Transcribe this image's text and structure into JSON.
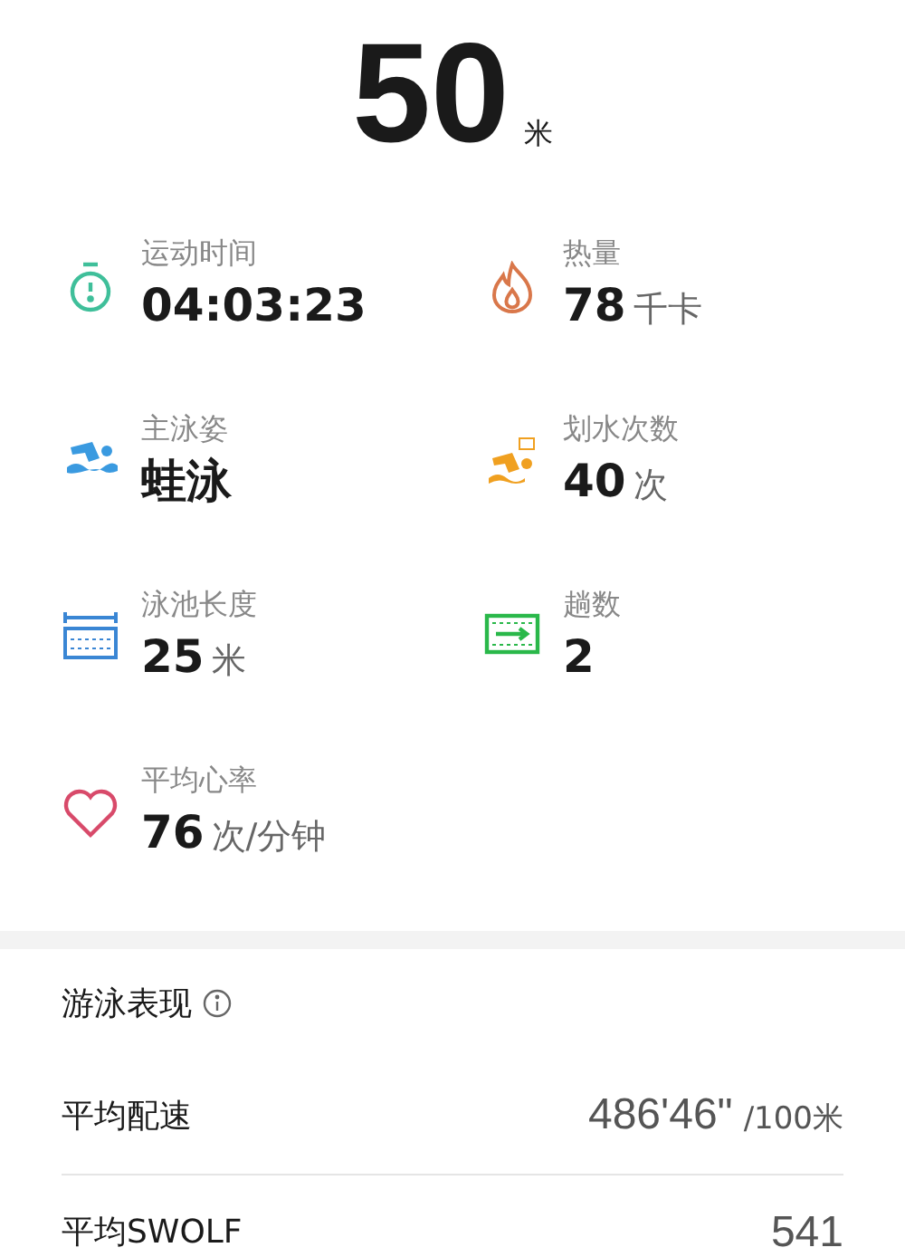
{
  "distance": {
    "value": "50",
    "unit": "米"
  },
  "stats": [
    {
      "label": "运动时间",
      "value": "04:03:23"
    },
    {
      "label": "热量",
      "value": "78",
      "unit": "千卡"
    },
    {
      "label": "主泳姿",
      "value": "蛙泳"
    },
    {
      "label": "划水次数",
      "value": "40",
      "unit": "次"
    },
    {
      "label": "泳池长度",
      "value": "25",
      "unit": "米"
    },
    {
      "label": "趟数",
      "value": "2"
    },
    {
      "label": "平均心率",
      "value": "76",
      "unit": "次/分钟"
    }
  ],
  "performance": {
    "title": "游泳表现",
    "metrics": [
      {
        "label": "平均配速",
        "value": "486'46\"",
        "unit": "/100米"
      },
      {
        "label": "平均SWOLF",
        "value": "541"
      }
    ]
  }
}
